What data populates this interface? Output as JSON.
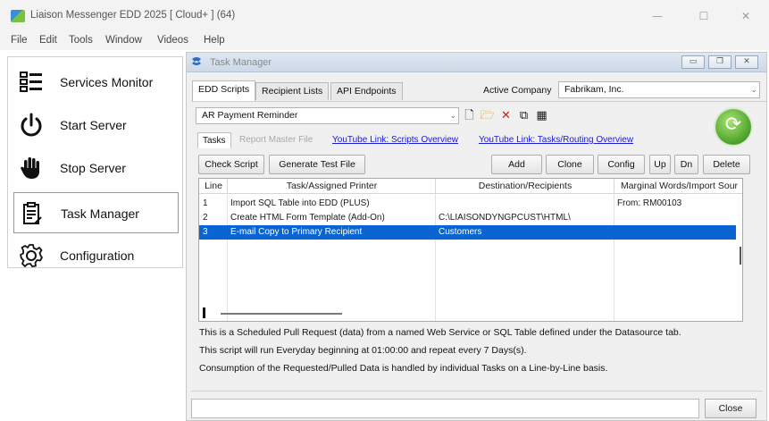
{
  "window": {
    "title": "Liaison Messenger EDD 2025 [ Cloud+ ] (64)",
    "controls": [
      "—",
      "☐",
      "✕"
    ]
  },
  "menu": [
    "File",
    "Edit",
    "Tools",
    "Window",
    "Videos",
    "Help"
  ],
  "nav": [
    {
      "label": "Services Monitor",
      "icon": "services-monitor-icon"
    },
    {
      "label": "Start Server",
      "icon": "power-icon"
    },
    {
      "label": "Stop Server",
      "icon": "hand-stop-icon"
    },
    {
      "label": "Task Manager",
      "icon": "clipboard-icon",
      "selected": true
    },
    {
      "label": "Configuration",
      "icon": "gear-icon"
    }
  ],
  "task_manager": {
    "title": "Task Manager",
    "tabs": [
      "EDD Scripts",
      "Recipient Lists",
      "API Endpoints"
    ],
    "active_company_label": "Active Company",
    "active_company": "Fabrikam, Inc.",
    "script": "AR Payment Reminder",
    "subtabs": [
      "Tasks",
      "Report Master File"
    ],
    "links": [
      "YouTube Link: Scripts Overview",
      "YouTube Link: Tasks/Routing Overview"
    ],
    "buttons": {
      "check_script": "Check Script",
      "generate_test_file": "Generate Test File",
      "add": "Add",
      "clone": "Clone",
      "config": "Config",
      "up": "Up",
      "dn": "Dn",
      "delete": "Delete"
    },
    "grid": {
      "columns": [
        "Line",
        "Task/Assigned Printer",
        "Destination/Recipients",
        "Marginal Words/Import Sour"
      ],
      "rows": [
        {
          "line": "1",
          "task": "Import SQL Table into EDD (PLUS)",
          "dest": "",
          "marginal": "From: RM00103"
        },
        {
          "line": "2",
          "task": "Create HTML Form Template (Add-On)",
          "dest": "C:\\LIAISONDYNGPCUST\\HTML\\",
          "marginal": ""
        },
        {
          "line": "3",
          "task": "E-mail Copy to Primary Recipient",
          "dest": "Customers",
          "marginal": "",
          "selected": true
        }
      ]
    },
    "info_lines": [
      "This is a Scheduled Pull Request (data) from a named Web Service or SQL Table defined under the Datasource tab.",
      "This script will run Everyday beginning at 01:00:00 and repeat every 7 Days(s).",
      "Consumption of the Requested/Pulled Data is handled by individual Tasks on a Line-by-Line basis."
    ],
    "close_label": "Close"
  },
  "colors": {
    "selection": "#0a64d2",
    "link": "#1a1ad0",
    "refresh": "#4ba12b"
  }
}
